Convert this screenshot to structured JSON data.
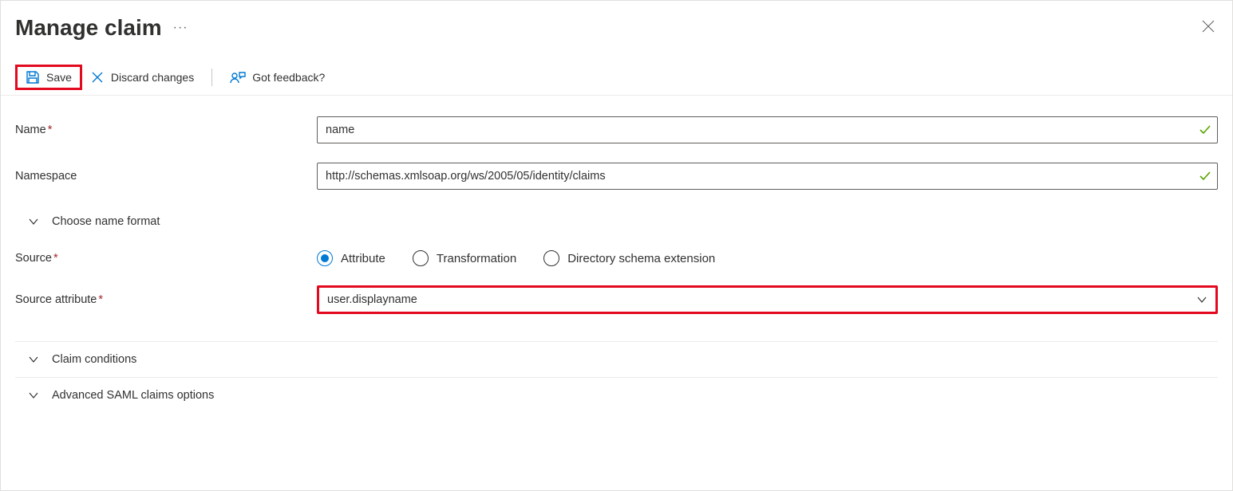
{
  "header": {
    "title": "Manage claim"
  },
  "toolbar": {
    "save_label": "Save",
    "discard_label": "Discard changes",
    "feedback_label": "Got feedback?"
  },
  "form": {
    "name": {
      "label": "Name",
      "value": "name",
      "required": true
    },
    "namespace": {
      "label": "Namespace",
      "value": "http://schemas.xmlsoap.org/ws/2005/05/identity/claims",
      "required": false
    },
    "choose_format": {
      "label": "Choose name format"
    },
    "source": {
      "label": "Source",
      "required": true,
      "options": [
        "Attribute",
        "Transformation",
        "Directory schema extension"
      ],
      "selected": "Attribute"
    },
    "source_attribute": {
      "label": "Source attribute",
      "required": true,
      "value": "user.displayname"
    },
    "claim_conditions": {
      "label": "Claim conditions"
    },
    "advanced_saml": {
      "label": "Advanced SAML claims options"
    }
  }
}
